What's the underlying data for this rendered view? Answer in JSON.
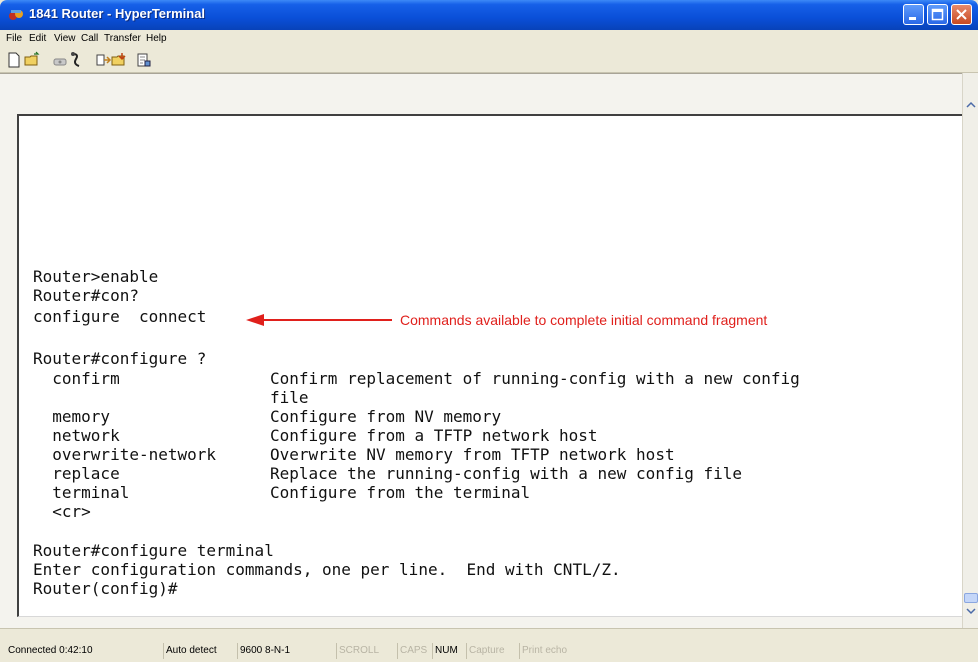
{
  "window": {
    "title": "1841 Router - HyperTerminal"
  },
  "menu": {
    "items": [
      "File",
      "Edit",
      "View",
      "Call",
      "Transfer",
      "Help"
    ]
  },
  "toolbar": {
    "buttons": [
      "new-document-icon",
      "open-folder-icon",
      "phone-icon",
      "disconnect-icon",
      "send-icon",
      "receive-icon",
      "properties-icon"
    ]
  },
  "terminal": {
    "lines": [
      "Router>enable",
      "Router#con?",
      "configure  connect",
      "Router#configure ?",
      "  confirm",
      "",
      "  memory",
      "  network",
      "  overwrite-network",
      "  replace",
      "  terminal",
      "  <cr>",
      "Router#configure terminal",
      "Enter configuration commands, one per line.  End with CNTL/Z.",
      "Router(config)#"
    ],
    "descriptions": {
      "confirm": "Confirm replacement of running-config with a new config",
      "confirm_wrap": "file",
      "memory": "Configure from NV memory",
      "network": "Configure from a TFTP network host",
      "overwrite_network": "Overwrite NV memory from TFTP network host",
      "replace": "Replace the running-config with a new config file",
      "terminal": "Configure from the terminal"
    },
    "annotation": "Commands available to complete initial command fragment",
    "annotation_color": "#e0201c"
  },
  "statusbar": {
    "connected": "Connected 0:42:10",
    "detect": "Auto detect",
    "settings": "9600 8-N-1",
    "scroll": "SCROLL",
    "caps": "CAPS",
    "num": "NUM",
    "capture": "Capture",
    "print_echo": "Print echo"
  }
}
